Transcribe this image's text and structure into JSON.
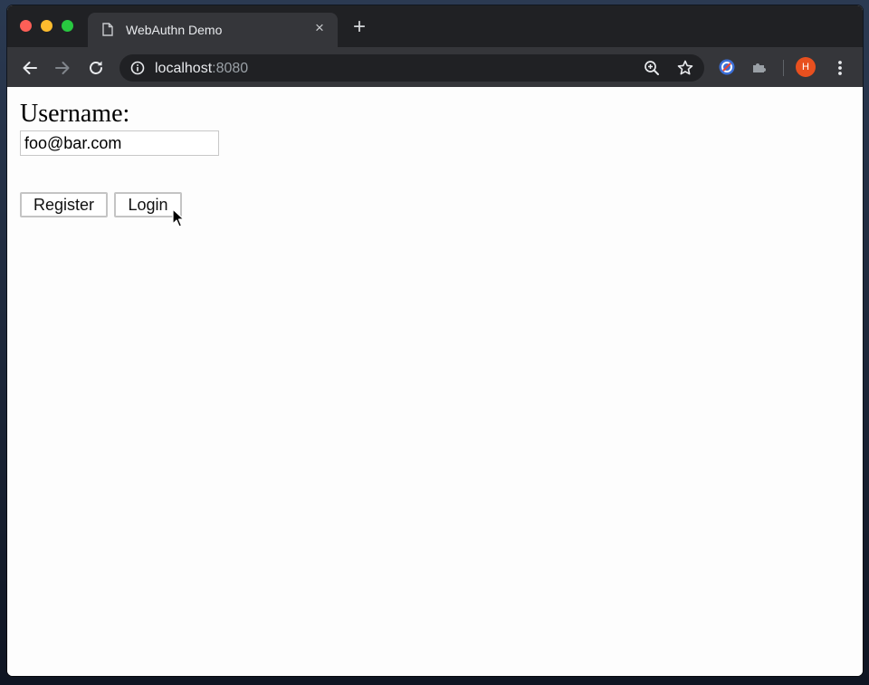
{
  "browser": {
    "tab": {
      "title": "WebAuthn Demo",
      "close_glyph": "×",
      "icon": "page-icon"
    },
    "new_tab_glyph": "+",
    "omnibox": {
      "host": "localhost",
      "port": ":8080"
    },
    "profile_initial": "H",
    "colors": {
      "profile": "#e8501f",
      "titlebar": "#202124",
      "toolbar": "#35363a"
    }
  },
  "page": {
    "username_label": "Username:",
    "username_value": "foo@bar.com",
    "register_label": "Register",
    "login_label": "Login"
  }
}
